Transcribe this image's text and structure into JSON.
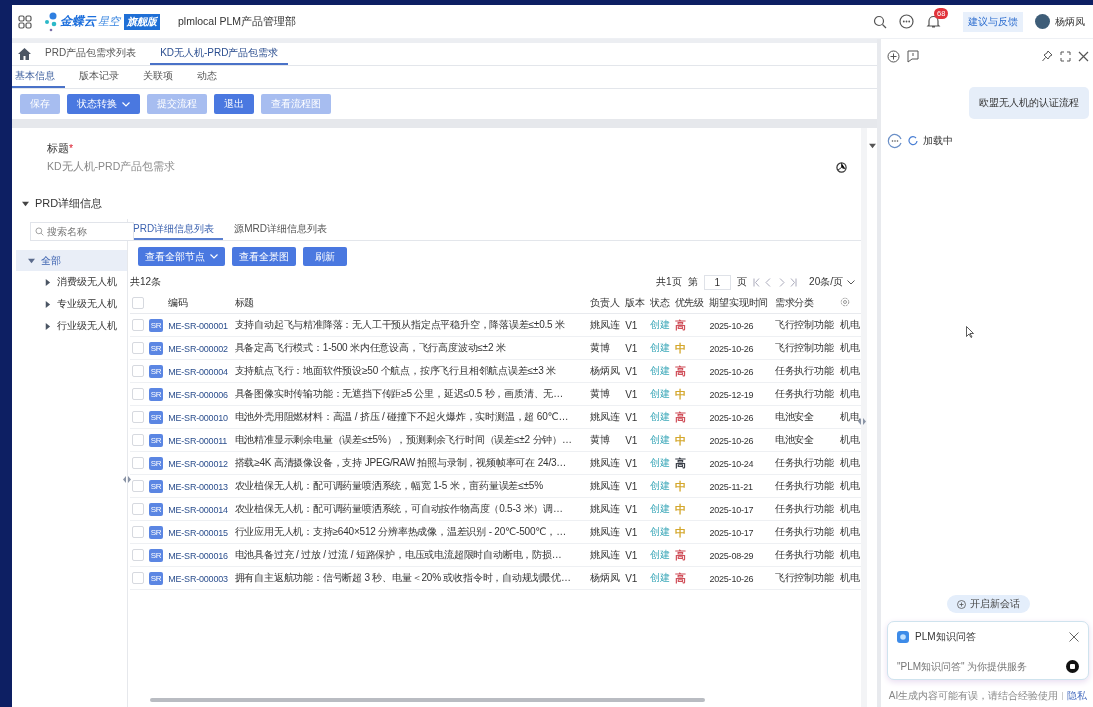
{
  "app_bar": {
    "brand": "金蝶云",
    "brand_sub": "星空",
    "edition": "旗舰版",
    "org": "plmlocal PLM产品管理部",
    "notification_count": "68",
    "feedback": "建议与反馈",
    "user": "杨炳凤"
  },
  "page_tabs": [
    {
      "label": "PRD产品包需求列表",
      "selected": false
    },
    {
      "label": "KD无人机-PRD产品包需求",
      "selected": true
    }
  ],
  "sub_tabs": [
    {
      "label": "基本信息",
      "selected": true
    },
    {
      "label": "版本记录",
      "selected": false
    },
    {
      "label": "关联项",
      "selected": false
    },
    {
      "label": "动态",
      "selected": false
    }
  ],
  "toolbar": [
    {
      "label": "保存",
      "disabled": true,
      "dropdown": false
    },
    {
      "label": "状态转换",
      "disabled": false,
      "dropdown": true
    },
    {
      "label": "提交流程",
      "disabled": true,
      "dropdown": false
    },
    {
      "label": "退出",
      "disabled": false,
      "dropdown": false
    },
    {
      "label": "查看流程图",
      "disabled": true,
      "dropdown": false
    }
  ],
  "title_field": {
    "label": "标题",
    "required": true,
    "required_mark": "*",
    "value": "KD无人机-PRD产品包需求"
  },
  "section": {
    "title": "PRD详细信息",
    "expanded": true
  },
  "tree": {
    "search_placeholder": "搜索名称",
    "items": [
      {
        "label": "全部",
        "expanded": true,
        "selected": true,
        "children": [
          {
            "label": "消费级无人机",
            "expanded": false,
            "selected": false
          },
          {
            "label": "专业级无人机",
            "expanded": false,
            "selected": false
          },
          {
            "label": "行业级无人机",
            "expanded": false,
            "selected": false
          }
        ]
      }
    ]
  },
  "detail_tabs": [
    {
      "label": "PRD详细信息列表",
      "selected": true
    },
    {
      "label": "源MRD详细信息列表",
      "selected": false
    }
  ],
  "table_buttons": [
    {
      "label": "查看全部节点",
      "dropdown": true
    },
    {
      "label": "查看全景图",
      "dropdown": false
    },
    {
      "label": "刷新",
      "dropdown": false
    }
  ],
  "table": {
    "total": "共12条",
    "all_checked": false,
    "pagination": {
      "pages": "共1页",
      "page_prefix": "第",
      "page": "1",
      "page_suffix": "页",
      "page_size": "20条/页"
    },
    "columns": [
      "编码",
      "标题",
      "负责人",
      "版本",
      "状态",
      "优先级",
      "期望实现时间",
      "需求分类"
    ],
    "rows": [
      {
        "type": "SR",
        "code": "ME-SR-000001",
        "title": "支持自动起飞与精准降落：无人工干预从指定点平稳升空，降落误差≤±0.5 米",
        "owner": "姚凤连",
        "version": "V1",
        "status": "创建",
        "priority": "高",
        "color": "#d0505a",
        "date": "2025-10-26",
        "category": "飞行控制功能",
        "column_11": "机电",
        "checked": false
      },
      {
        "type": "SR",
        "code": "ME-SR-000002",
        "title": "具备定高飞行模式：1-500 米内任意设高，飞行高度波动≤±2 米",
        "owner": "黄博",
        "version": "V1",
        "status": "创建",
        "priority": "中",
        "color": "#d4a72c",
        "date": "2025-10-26",
        "category": "飞行控制功能",
        "column_11": "机电",
        "checked": false
      },
      {
        "type": "SR",
        "code": "ME-SR-000004",
        "title": "支持航点飞行：地面软件预设≥50 个航点，按序飞行且相邻航点误差≤±3 米",
        "owner": "杨炳凤",
        "version": "V1",
        "status": "创建",
        "priority": "高",
        "color": "#d0505a",
        "date": "2025-10-26",
        "category": "任务执行功能",
        "column_11": "机电",
        "checked": false
      },
      {
        "type": "SR",
        "code": "ME-SR-000006",
        "title": "具备图像实时传输功能：无遮挡下传距≥5 公里，延迟≤0.5 秒，画质清、无…",
        "owner": "黄博",
        "version": "V1",
        "status": "创建",
        "priority": "中",
        "color": "#d4a72c",
        "date": "2025-12-19",
        "category": "任务执行功能",
        "column_11": "机电",
        "checked": false
      },
      {
        "type": "SR",
        "code": "ME-SR-000010",
        "title": "电池外壳用阻燃材料：高温 / 挤压 / 碰撞下不起火爆炸，实时测温，超 60℃…",
        "owner": "姚凤连",
        "version": "V1",
        "status": "创建",
        "priority": "高",
        "color": "#d0505a",
        "date": "2025-10-26",
        "category": "电池安全",
        "column_11": "机电",
        "checked": false
      },
      {
        "type": "SR",
        "code": "ME-SR-000011",
        "title": "电池精准显示剩余电量（误差≤±5%），预测剩余飞行时间（误差≤±2 分钟）…",
        "owner": "黄博",
        "version": "V1",
        "status": "创建",
        "priority": "中",
        "color": "#d4a72c",
        "date": "2025-10-26",
        "category": "电池安全",
        "column_11": "机电",
        "checked": false
      },
      {
        "type": "SR",
        "code": "ME-SR-000012",
        "title": "搭载≥4K 高清摄像设备，支持 JPEG/RAW 拍照与录制，视频帧率可在 24/3…",
        "owner": "姚凤连",
        "version": "V1",
        "status": "创建",
        "priority": "高",
        "color": "#3a3f48",
        "date": "2025-10-24",
        "category": "任务执行功能",
        "column_11": "机电",
        "checked": false
      },
      {
        "type": "SR",
        "code": "ME-SR-000013",
        "title": "农业植保无人机：配可调药量喷洒系统，幅宽 1-5 米，亩药量误差≤±5%",
        "owner": "姚凤连",
        "version": "V1",
        "status": "创建",
        "priority": "中",
        "color": "#d4a72c",
        "date": "2025-11-21",
        "category": "任务执行功能",
        "column_11": "机电",
        "checked": false
      },
      {
        "type": "SR",
        "code": "ME-SR-000014",
        "title": "农业植保无人机：配可调药量喷洒系统，可自动按作物高度（0.5-3 米）调…",
        "owner": "姚凤连",
        "version": "V1",
        "status": "创建",
        "priority": "中",
        "color": "#d4a72c",
        "date": "2025-10-17",
        "category": "任务执行功能",
        "column_11": "机电",
        "checked": false
      },
      {
        "type": "SR",
        "code": "ME-SR-000015",
        "title": "行业应用无人机：支持≥640×512 分辨率热成像，温差识别 - 20℃-500℃，…",
        "owner": "姚凤连",
        "version": "V1",
        "status": "创建",
        "priority": "中",
        "color": "#d4a72c",
        "date": "2025-10-17",
        "category": "任务执行功能",
        "column_11": "机电",
        "checked": false
      },
      {
        "type": "SR",
        "code": "ME-SR-000016",
        "title": "电池具备过充 / 过放 / 过流 / 短路保护，电压或电流超限时自动断电，防损…",
        "owner": "姚凤连",
        "version": "V1",
        "status": "创建",
        "priority": "高",
        "color": "#d0505a",
        "date": "2025-08-29",
        "category": "任务执行功能",
        "column_11": "机电",
        "checked": false
      },
      {
        "type": "SR",
        "code": "ME-SR-000003",
        "title": "拥有自主返航功能：信号断超 3 秒、电量＜20% 或收指令时，自动规划最优…",
        "owner": "杨炳凤",
        "version": "V1",
        "status": "创建",
        "priority": "高",
        "color": "#d0505a",
        "date": "2025-10-26",
        "category": "飞行控制功能",
        "column_11": "机电",
        "checked": false
      }
    ]
  },
  "chat": {
    "user_message": "欧盟无人机的认证流程",
    "loading": "加载中",
    "new_chat": "开启新会话",
    "assistant_name": "PLM知识问答",
    "placeholder": "\"PLM知识问答\" 为你提供服务",
    "disclaimer": "AI生成内容可能有误，请结合经验使用",
    "privacy": "隐私"
  }
}
